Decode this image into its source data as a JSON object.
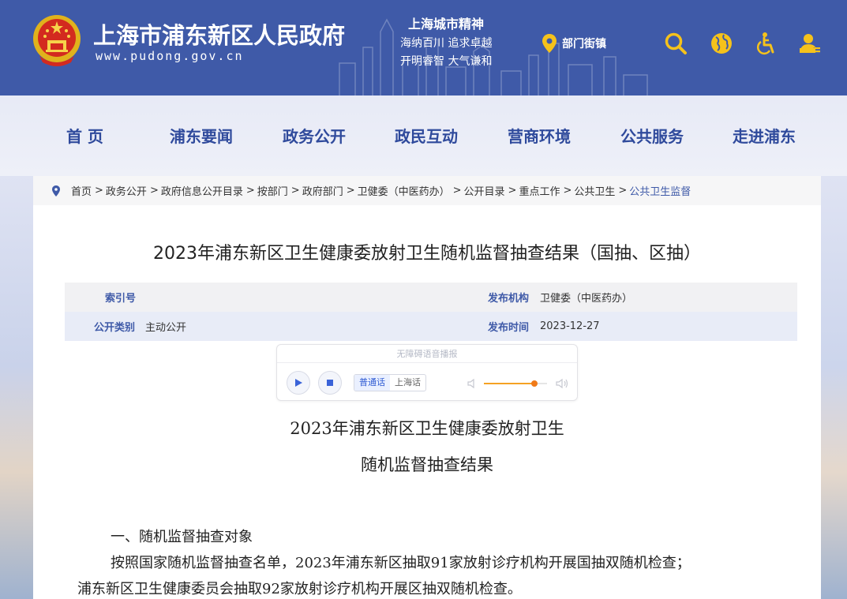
{
  "header": {
    "site_title": "上海市浦东新区人民政府",
    "site_url": "www.pudong.gov.cn",
    "spirit_title": "上海城市精神",
    "spirit_line1": "海纳百川  追求卓越",
    "spirit_line2": "开明睿智  大气谦和",
    "dept_link": "部门街镇",
    "icons": [
      "location-pin-icon",
      "search-icon",
      "globe-icon",
      "accessibility-icon",
      "user-icon"
    ],
    "colors": {
      "header_bg": "#3f5aa8",
      "icon_yellow": "#f5c21b"
    }
  },
  "nav": {
    "items": [
      "首  页",
      "浦东要闻",
      "政务公开",
      "政民互动",
      "营商环境",
      "公共服务",
      "走进浦东"
    ],
    "color": "#2f4a9c"
  },
  "breadcrumb": {
    "items": [
      "首页",
      "政务公开",
      "政府信息公开目录",
      "按部门",
      "政府部门",
      "卫健委（中医药办）",
      "公开目录",
      "重点工作",
      "公共卫生",
      "公共卫生监督"
    ],
    "separator": ">"
  },
  "article": {
    "title": "2023年浦东新区卫生健康委放射卫生随机监督抽查结果（国抽、区抽）",
    "meta": {
      "index_label": "索引号",
      "index_value": "",
      "publisher_label": "发布机构",
      "publisher_value": "卫健委（中医药办）",
      "category_label": "公开类别",
      "category_value": "主动公开",
      "date_label": "发布时间",
      "date_value": "2023-12-27"
    },
    "player": {
      "hint": "无障碍语音播报",
      "lang_mandarin": "普通话",
      "lang_shanghai": "上海话",
      "selected_lang": "普通话",
      "volume_fraction": 0.8
    },
    "subtitle_line1": "2023年浦东新区卫生健康委放射卫生",
    "subtitle_line2": "随机监督抽查结果",
    "section1_heading": "一、随机监督抽查对象",
    "para1": "按照国家随机监督抽查名单，2023年浦东新区抽取91家放射诊疗机构开展国抽双随机检查；",
    "para2": "浦东新区卫生健康委员会抽取92家放射诊疗机构开展区抽双随机检查。"
  }
}
